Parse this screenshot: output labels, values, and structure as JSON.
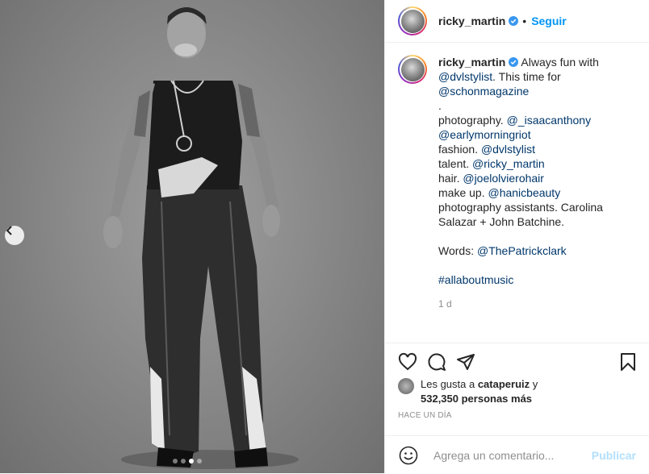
{
  "post": {
    "username": "ricky_martin",
    "follow_label": "Seguir",
    "separator": "•",
    "caption_lines": [
      {
        "parts": [
          {
            "t": "Always fun with ",
            "m": false
          }
        ]
      },
      {
        "parts": [
          {
            "t": "@dvlstylist",
            "m": true
          },
          {
            "t": ". This time for",
            "m": false
          }
        ]
      },
      {
        "parts": [
          {
            "t": "@schonmagazine",
            "m": true
          }
        ]
      },
      {
        "parts": [
          {
            "t": ".",
            "m": false
          }
        ]
      },
      {
        "parts": [
          {
            "t": "photography. ",
            "m": false
          },
          {
            "t": "@_isaacanthony",
            "m": true
          }
        ]
      },
      {
        "parts": [
          {
            "t": "@earlymorningriot",
            "m": true
          }
        ]
      },
      {
        "parts": [
          {
            "t": "fashion. ",
            "m": false
          },
          {
            "t": "@dvlstylist",
            "m": true
          }
        ]
      },
      {
        "parts": [
          {
            "t": "talent. ",
            "m": false
          },
          {
            "t": "@ricky_martin",
            "m": true
          }
        ]
      },
      {
        "parts": [
          {
            "t": "hair. ",
            "m": false
          },
          {
            "t": "@joelolvierohair",
            "m": true
          }
        ]
      },
      {
        "parts": [
          {
            "t": "make up. ",
            "m": false
          },
          {
            "t": "@hanicbeauty",
            "m": true
          }
        ]
      },
      {
        "parts": [
          {
            "t": "photography assistants. Carolina",
            "m": false
          }
        ]
      },
      {
        "parts": [
          {
            "t": "Salazar + John Batchine.",
            "m": false
          }
        ]
      },
      {
        "parts": [
          {
            "t": "",
            "m": false
          }
        ]
      },
      {
        "parts": [
          {
            "t": "Words: ",
            "m": false
          },
          {
            "t": "@ThePatrickclark",
            "m": true
          }
        ]
      },
      {
        "parts": [
          {
            "t": "",
            "m": false
          }
        ]
      },
      {
        "parts": [
          {
            "t": "#allaboutmusic",
            "m": true
          }
        ]
      }
    ],
    "caption_age": "1 d",
    "likes_prefix": "Les gusta a ",
    "likes_user": "cataperuiz",
    "likes_suffix": " y",
    "likes_count_text": "532,350 personas más",
    "timestamp": "HACE UN DÍA",
    "comment_placeholder": "Agrega un comentario...",
    "publish_label": "Publicar",
    "carousel": {
      "total": 4,
      "active": 2
    }
  },
  "icons": {
    "verified": "verified-badge-icon",
    "heart": "heart-icon",
    "comment": "comment-icon",
    "share": "share-icon",
    "save": "bookmark-icon",
    "emoji": "emoji-icon",
    "prev": "chevron-left-icon"
  },
  "colors": {
    "accent": "#0095f6",
    "mention": "#00376b",
    "muted": "#8e8e8e",
    "publish_disabled": "#b2dffc"
  }
}
